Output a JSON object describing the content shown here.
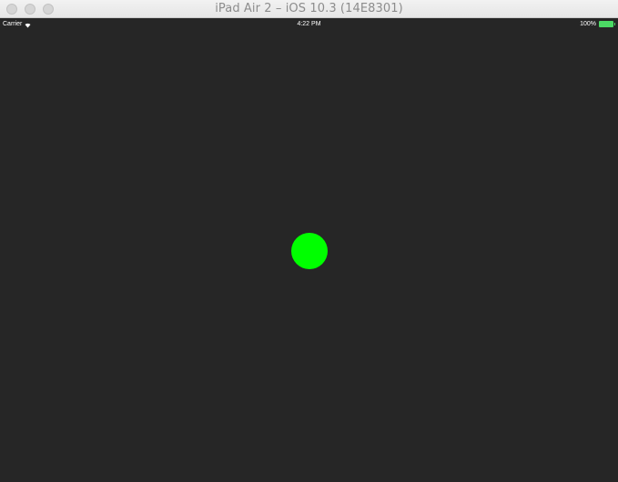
{
  "window": {
    "title": "iPad Air 2 – iOS 10.3 (14E8301)"
  },
  "statusbar": {
    "carrier": "Carrier",
    "time": "4:22 PM",
    "battery_percent_text": "100%",
    "battery_level": 1.0
  },
  "icons": {
    "close": "close-dot",
    "minimize": "minimize-dot",
    "zoom": "zoom-dot",
    "wifi": "wifi-icon",
    "battery": "battery-icon"
  },
  "colors": {
    "background": "#262626",
    "circle": "#00ff00",
    "battery": "#4cd964"
  }
}
